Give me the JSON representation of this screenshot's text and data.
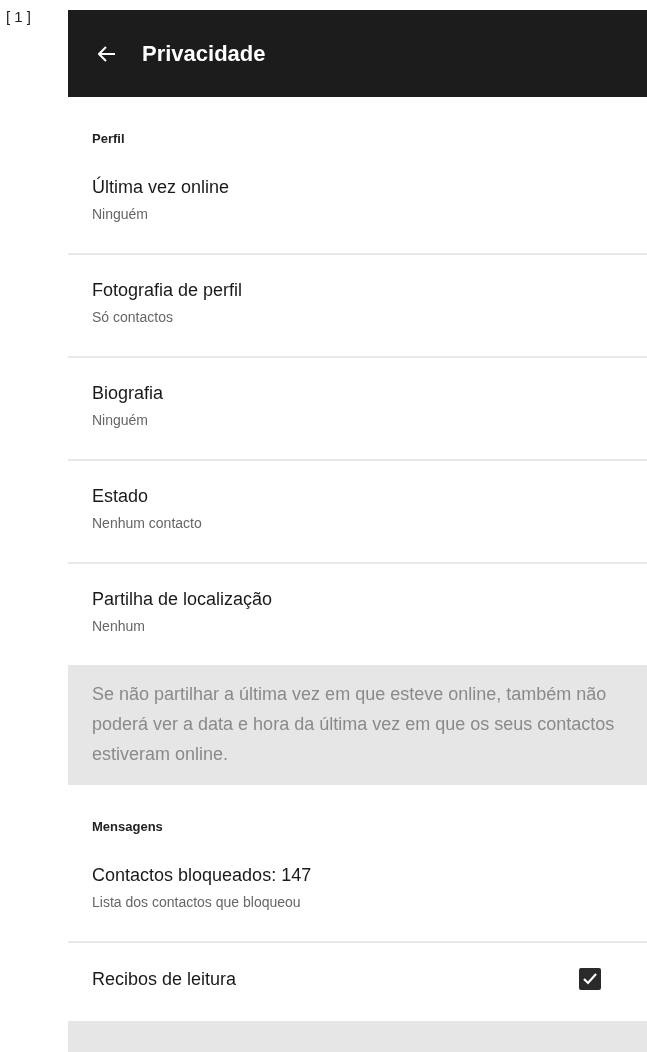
{
  "figure_label": "[ 1 ]",
  "header": {
    "title": "Privacidade"
  },
  "sections": [
    {
      "title": "Perfil",
      "items": [
        {
          "kind": "setting",
          "title": "Última vez online",
          "subtitle": "Ninguém"
        },
        {
          "kind": "setting",
          "title": "Fotografia de perfil",
          "subtitle": "Só contactos"
        },
        {
          "kind": "setting",
          "title": "Biografia",
          "subtitle": "Ninguém"
        },
        {
          "kind": "setting",
          "title": "Estado",
          "subtitle": "Nenhum contacto"
        },
        {
          "kind": "setting",
          "title": "Partilha de localização",
          "subtitle": "Nenhum"
        }
      ],
      "note": "Se não partilhar a última vez em que esteve online, também não poderá ver a data e hora da última vez em que os seus contactos estiveram online."
    },
    {
      "title": "Mensagens",
      "items": [
        {
          "kind": "setting",
          "title": "Contactos bloqueados: 147",
          "subtitle": "Lista dos contactos que bloqueou"
        },
        {
          "kind": "checkbox",
          "title": "Recibos de leitura",
          "checked": true
        }
      ]
    }
  ]
}
